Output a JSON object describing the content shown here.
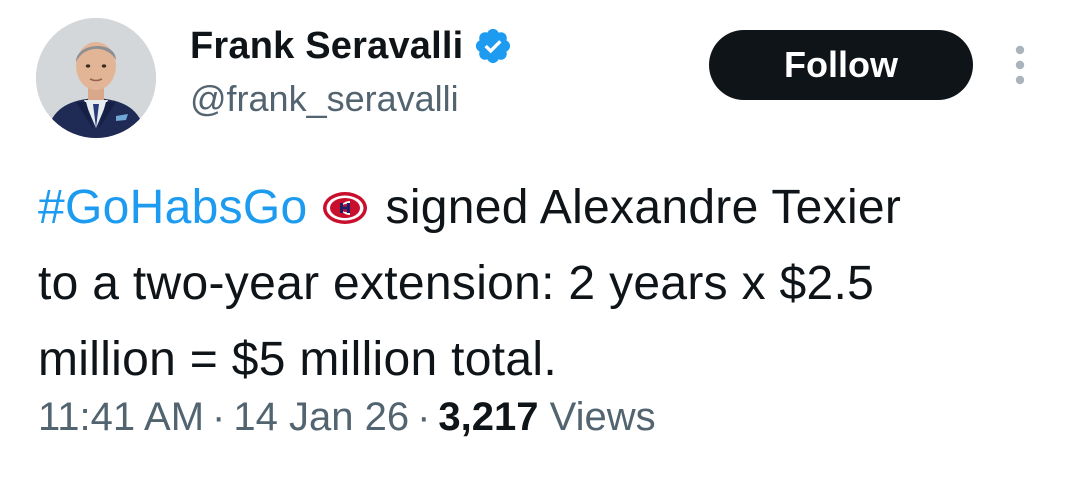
{
  "author": {
    "display_name": "Frank Seravalli",
    "handle": "@frank_seravalli",
    "verified": true,
    "avatar": "profile-photo"
  },
  "actions": {
    "follow_label": "Follow",
    "more_icon": "vertical-ellipsis-icon"
  },
  "tweet": {
    "hashtag": "#GoHabsGo",
    "emoji": "montreal-canadiens-logo",
    "text_line1": "signed Alexandre Texier",
    "text_line2": "to a two-year extension: 2 years x $2.5",
    "text_line3": "million = $5 million total."
  },
  "meta": {
    "time": "11:41 AM",
    "separator": "·",
    "date": "14 Jan 26",
    "view_count": "3,217",
    "views_label": "Views"
  },
  "colors": {
    "accent": "#1d9bf0",
    "text": "#0f1419",
    "secondary": "#536471",
    "button_bg": "#0f1419",
    "habs_red": "#c8102e",
    "habs_blue": "#192168"
  }
}
